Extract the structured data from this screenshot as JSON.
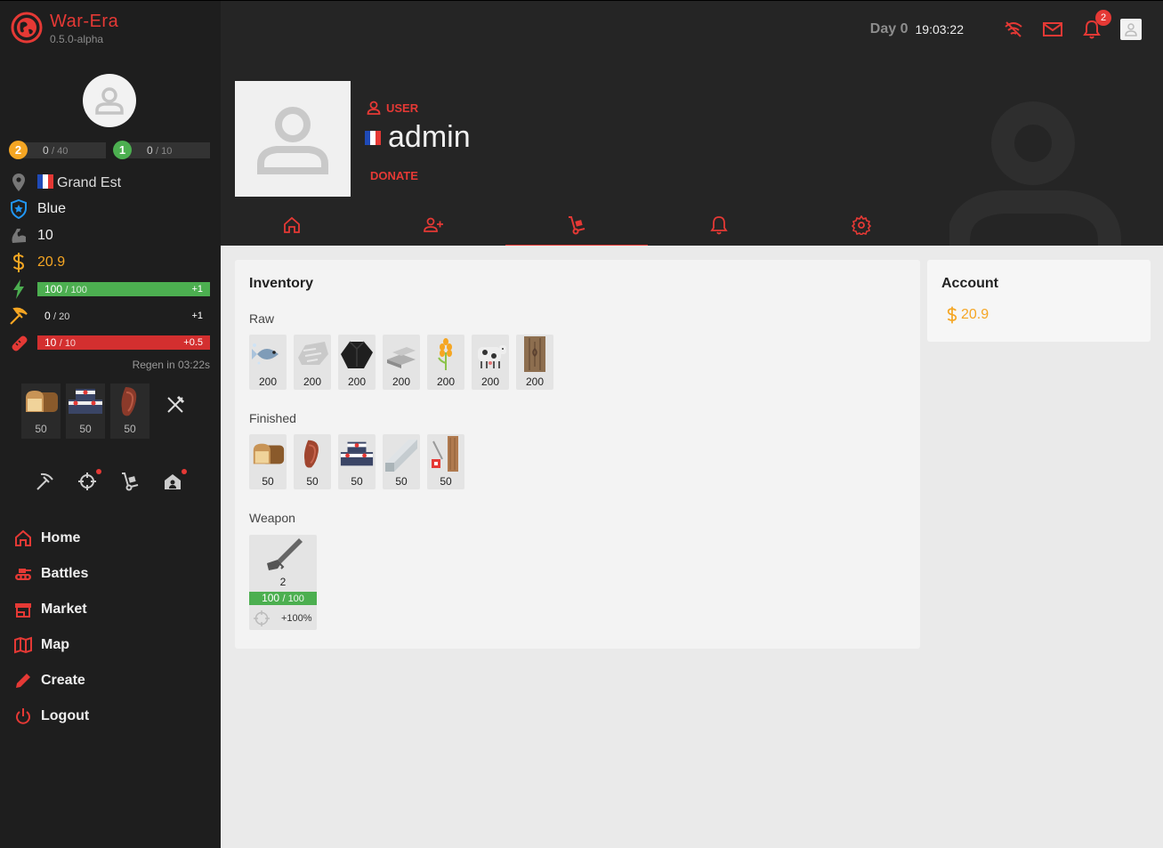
{
  "app": {
    "name": "War-Era",
    "version": "0.5.0-alpha"
  },
  "colors": {
    "accent": "#e53935",
    "energy": "#4caf50",
    "health": "#d32f2f",
    "money": "#f5a623",
    "level_gold": "#f5a623",
    "level_green": "#4caf50"
  },
  "sidebar": {
    "level": {
      "value": "2",
      "current": "0",
      "max": "/ 40"
    },
    "military": {
      "value": "1",
      "current": "0",
      "max": "/ 10"
    },
    "region": "Grand Est",
    "party": "Blue",
    "strength": "10",
    "money": "20.9",
    "energy": {
      "current": "100",
      "max": "/ 100",
      "regen": "+1",
      "fill": 1.0
    },
    "work": {
      "current": "0",
      "max": "/ 20",
      "regen": "+1",
      "fill": 0.0
    },
    "health": {
      "current": "10",
      "max": "/ 10",
      "regen": "+0.5",
      "fill": 1.0
    },
    "regen_text": "Regen in 03:22s",
    "food": [
      {
        "icon": "bread-icon",
        "qty": "50"
      },
      {
        "icon": "sushi-icon",
        "qty": "50"
      },
      {
        "icon": "steak-icon",
        "qty": "50"
      }
    ],
    "nav": [
      {
        "label": "Home",
        "icon": "home-icon"
      },
      {
        "label": "Battles",
        "icon": "tank-icon"
      },
      {
        "label": "Market",
        "icon": "store-icon"
      },
      {
        "label": "Map",
        "icon": "map-icon"
      },
      {
        "label": "Create",
        "icon": "pencil-icon"
      },
      {
        "label": "Logout",
        "icon": "power-icon"
      }
    ]
  },
  "topbar": {
    "day": "Day 0",
    "time": "19:03:22",
    "notifications": "2"
  },
  "profile": {
    "role": "USER",
    "username": "admin",
    "donate": "DONATE"
  },
  "tabs": [
    {
      "icon": "home-icon"
    },
    {
      "icon": "user-network-icon"
    },
    {
      "icon": "hand-truck-icon",
      "active": true
    },
    {
      "icon": "bell-icon"
    },
    {
      "icon": "gear-icon"
    }
  ],
  "inventory": {
    "title": "Inventory",
    "raw_label": "Raw",
    "raw": [
      {
        "icon": "fish-icon",
        "qty": "200"
      },
      {
        "icon": "limestone-icon",
        "qty": "200"
      },
      {
        "icon": "coal-icon",
        "qty": "200"
      },
      {
        "icon": "iron-icon",
        "qty": "200"
      },
      {
        "icon": "grain-icon",
        "qty": "200"
      },
      {
        "icon": "cow-icon",
        "qty": "200"
      },
      {
        "icon": "wood-icon",
        "qty": "200"
      }
    ],
    "finished_label": "Finished",
    "finished": [
      {
        "icon": "bread-icon",
        "qty": "50"
      },
      {
        "icon": "steak-icon",
        "qty": "50"
      },
      {
        "icon": "sushi-icon",
        "qty": "50"
      },
      {
        "icon": "concrete-icon",
        "qty": "50"
      },
      {
        "icon": "plank-icon",
        "qty": "50"
      }
    ],
    "weapon_label": "Weapon",
    "weapon": {
      "icon": "pistol-icon",
      "qty": "2",
      "durability": "100",
      "durability_max": "/ 100",
      "fill": 1.0,
      "bonus": "+100%"
    }
  },
  "account": {
    "title": "Account",
    "money": "20.9"
  }
}
